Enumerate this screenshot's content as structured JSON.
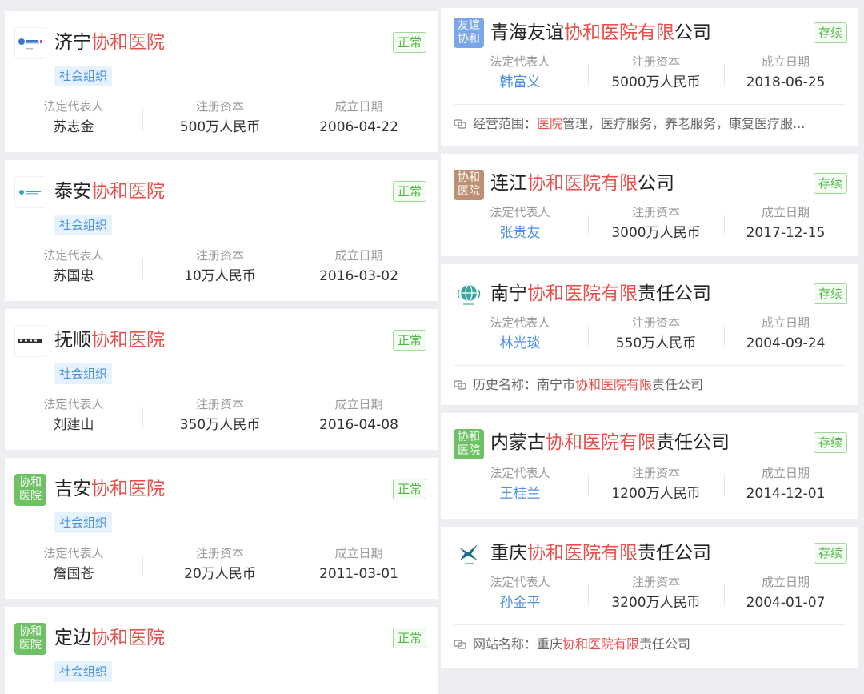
{
  "labels": {
    "legal_rep": "法定代表人",
    "capital": "注册资本",
    "date": "成立日期",
    "scope_label": "经营范围：",
    "history_label": "历史名称：",
    "website_label": "网站名称："
  },
  "left_cards": [
    {
      "prefix": "济宁",
      "highlight": "协和医院",
      "suffix": "",
      "logo_icon": "jining-hospital-emblem-icon",
      "status": "正常",
      "tag": "社会组织",
      "rep": "苏志金",
      "capital": "500万人民币",
      "date": "2006-04-22"
    },
    {
      "prefix": "泰安",
      "highlight": "协和医院",
      "suffix": "",
      "logo_icon": "taian-hospital-emblem-icon",
      "status": "正常",
      "tag": "社会组织",
      "rep": "苏国忠",
      "capital": "10万人民币",
      "date": "2016-03-02"
    },
    {
      "prefix": "抚顺",
      "highlight": "协和医院",
      "suffix": "",
      "logo_icon": "fushun-hospital-emblem-icon",
      "status": "正常",
      "tag": "社会组织",
      "rep": "刘建山",
      "capital": "350万人民币",
      "date": "2016-04-08"
    },
    {
      "prefix": "吉安",
      "highlight": "协和医院",
      "suffix": "",
      "logo_text": "协和医院",
      "status": "正常",
      "tag": "社会组织",
      "rep": "詹国苍",
      "capital": "20万人民币",
      "date": "2011-03-01"
    },
    {
      "prefix": "定边",
      "highlight": "协和医院",
      "suffix": "",
      "logo_text": "协和医院",
      "status": "正常",
      "tag": "社会组织"
    }
  ],
  "right_cards": [
    {
      "prefix": "青海友谊",
      "highlight": "协和医院有限",
      "suffix": "公司",
      "logo_text": "友谊协和",
      "status": "存续",
      "rep": "韩富义",
      "capital": "5000万人民币",
      "date": "2018-06-25",
      "extra_pre": "",
      "extra_hl": "医院",
      "extra_post": "管理，医疗服务，养老服务，康复医疗服..."
    },
    {
      "prefix": "连江",
      "highlight": "协和医院有限",
      "suffix": "公司",
      "logo_text": "协和医院",
      "status": "存续",
      "rep": "张贵友",
      "capital": "3000万人民币",
      "date": "2017-12-15"
    },
    {
      "prefix": "南宁",
      "highlight": "协和医院有限",
      "suffix": "责任公司",
      "logo_icon": "nanning-globe-icon",
      "status": "存续",
      "rep": "林光琰",
      "capital": "550万人民币",
      "date": "2004-09-24",
      "extra_pre": "南宁市",
      "extra_hl": "协和医院有限",
      "extra_post": "责任公司"
    },
    {
      "prefix": "内蒙古",
      "highlight": "协和医院有限",
      "suffix": "责任公司",
      "logo_text": "协和医院",
      "status": "存续",
      "rep": "王桂兰",
      "capital": "1200万人民币",
      "date": "2014-12-01"
    },
    {
      "prefix": "重庆",
      "highlight": "协和医院有限",
      "suffix": "责任公司",
      "logo_icon": "chongqing-bird-icon",
      "status": "存续",
      "rep": "孙金平",
      "capital": "3200万人民币",
      "date": "2004-01-07",
      "extra_pre": "重庆",
      "extra_hl": "协和医院有限",
      "extra_post": "责任公司"
    }
  ],
  "colors": {
    "highlight": "#e8504b",
    "status_green": "#4fba45",
    "tag_blue": "#4a90e2",
    "logo_green": "#6ec265",
    "logo_blue": "#79a6e8",
    "logo_brown": "#bd8f73"
  }
}
